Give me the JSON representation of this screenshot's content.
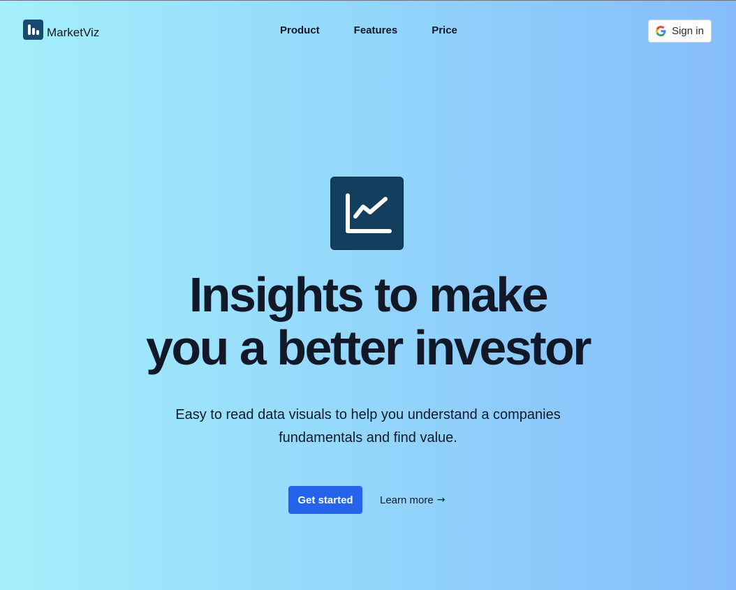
{
  "brand": {
    "name": "MarketViz",
    "logo_icon": "bar-chart-icon",
    "color": "#164a6e"
  },
  "nav": {
    "links": [
      {
        "label": "Product"
      },
      {
        "label": "Features"
      },
      {
        "label": "Price"
      }
    ]
  },
  "auth": {
    "signin_label": "Sign in",
    "signin_icon": "google-icon"
  },
  "hero": {
    "icon": "line-chart-icon",
    "headline_line1": "Insights to make",
    "headline_line2": "you a better investor",
    "subtitle_line1": "Easy to read data visuals to help you understand a companies",
    "subtitle_line2": "fundamentals and find value.",
    "primary_cta": "Get started",
    "secondary_cta": "Learn more",
    "secondary_cta_icon": "arrow-right-icon"
  },
  "colors": {
    "accent": "#2563eb",
    "icon_bg": "#133e5d",
    "gradient_start": "#a5f0fb",
    "gradient_end": "#86bcfb"
  }
}
